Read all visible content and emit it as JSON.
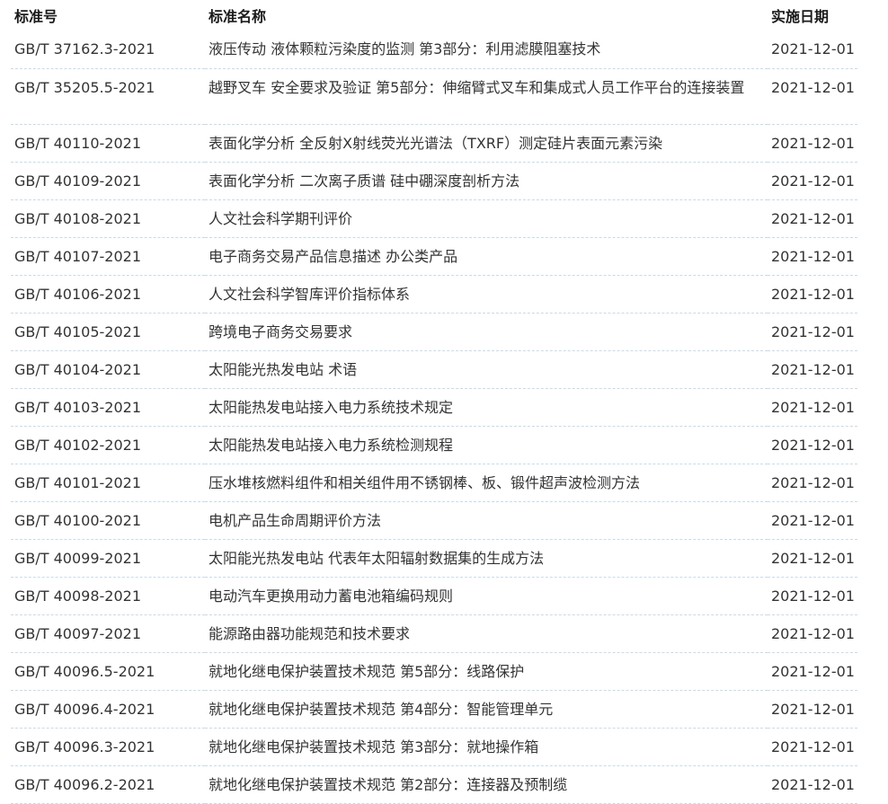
{
  "table": {
    "headers": {
      "code": "标准号",
      "name": "标准名称",
      "date": "实施日期"
    },
    "rows": [
      {
        "code": "GB/T 37162.3-2021",
        "name": "液压传动 液体颗粒污染度的监测 第3部分：利用滤膜阻塞技术",
        "date": "2021-12-01"
      },
      {
        "code": "GB/T 35205.5-2021",
        "name": "越野叉车 安全要求及验证 第5部分：伸缩臂式叉车和集成式人员工作平台的连接装置",
        "date": "2021-12-01"
      },
      {
        "code": "GB/T 40110-2021",
        "name": "表面化学分析 全反射X射线荧光光谱法（TXRF）测定硅片表面元素污染",
        "date": "2021-12-01"
      },
      {
        "code": "GB/T 40109-2021",
        "name": "表面化学分析 二次离子质谱 硅中硼深度剖析方法",
        "date": "2021-12-01"
      },
      {
        "code": "GB/T 40108-2021",
        "name": "人文社会科学期刊评价",
        "date": "2021-12-01"
      },
      {
        "code": "GB/T 40107-2021",
        "name": "电子商务交易产品信息描述 办公类产品",
        "date": "2021-12-01"
      },
      {
        "code": "GB/T 40106-2021",
        "name": "人文社会科学智库评价指标体系",
        "date": "2021-12-01"
      },
      {
        "code": "GB/T 40105-2021",
        "name": "跨境电子商务交易要求",
        "date": "2021-12-01"
      },
      {
        "code": "GB/T 40104-2021",
        "name": "太阳能光热发电站 术语",
        "date": "2021-12-01"
      },
      {
        "code": "GB/T 40103-2021",
        "name": "太阳能热发电站接入电力系统技术规定",
        "date": "2021-12-01"
      },
      {
        "code": "GB/T 40102-2021",
        "name": "太阳能热发电站接入电力系统检测规程",
        "date": "2021-12-01"
      },
      {
        "code": "GB/T 40101-2021",
        "name": "压水堆核燃料组件和相关组件用不锈钢棒、板、锻件超声波检测方法",
        "date": "2021-12-01"
      },
      {
        "code": "GB/T 40100-2021",
        "name": "电机产品生命周期评价方法",
        "date": "2021-12-01"
      },
      {
        "code": "GB/T 40099-2021",
        "name": "太阳能光热发电站 代表年太阳辐射数据集的生成方法",
        "date": "2021-12-01"
      },
      {
        "code": "GB/T 40098-2021",
        "name": "电动汽车更换用动力蓄电池箱编码规则",
        "date": "2021-12-01"
      },
      {
        "code": "GB/T 40097-2021",
        "name": "能源路由器功能规范和技术要求",
        "date": "2021-12-01"
      },
      {
        "code": "GB/T 40096.5-2021",
        "name": "就地化继电保护装置技术规范 第5部分：线路保护",
        "date": "2021-12-01"
      },
      {
        "code": "GB/T 40096.4-2021",
        "name": "就地化继电保护装置技术规范 第4部分：智能管理单元",
        "date": "2021-12-01"
      },
      {
        "code": "GB/T 40096.3-2021",
        "name": "就地化继电保护装置技术规范 第3部分：就地操作箱",
        "date": "2021-12-01"
      },
      {
        "code": "GB/T 40096.2-2021",
        "name": "就地化继电保护装置技术规范 第2部分：连接器及预制缆",
        "date": "2021-12-01"
      }
    ]
  }
}
